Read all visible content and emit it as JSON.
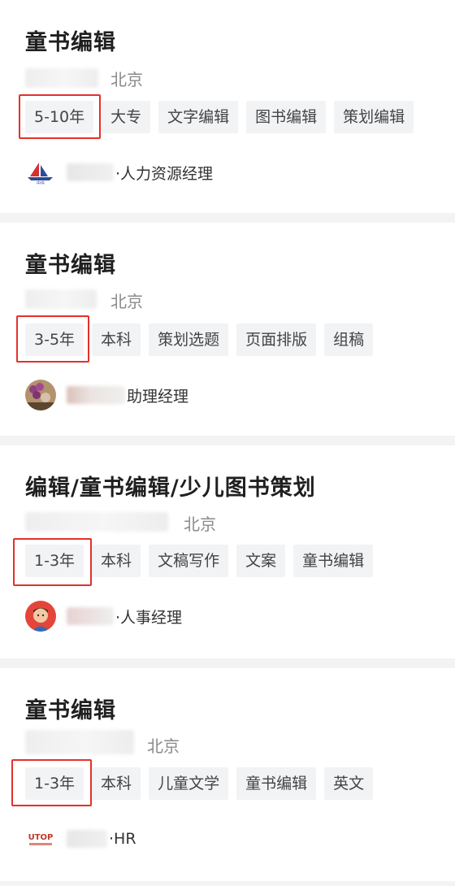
{
  "jobs": [
    {
      "title": "童书编辑",
      "city": "北京",
      "tags": [
        "5-10年",
        "大专",
        "文字编辑",
        "图书编辑",
        "策划编辑"
      ],
      "recruiter_role": "·人力资源经理",
      "recruiter_visual": "ship-logo-icon"
    },
    {
      "title": "童书编辑",
      "city": "北京",
      "tags": [
        "3-5年",
        "本科",
        "策划选题",
        "页面排版",
        "组稿"
      ],
      "recruiter_role": "助理经理",
      "recruiter_visual": "flower-avatar"
    },
    {
      "title": "编辑/童书编辑/少儿图书策划",
      "city": "北京",
      "tags": [
        "1-3年",
        "本科",
        "文稿写作",
        "文案",
        "童书编辑"
      ],
      "recruiter_role": "·人事经理",
      "recruiter_visual": "cartoon-person-avatar"
    },
    {
      "title": "童书编辑",
      "city": "北京",
      "tags": [
        "1-3年",
        "本科",
        "儿童文学",
        "童书编辑",
        "英文"
      ],
      "recruiter_role": "·HR",
      "recruiter_visual": "utop-logo-icon"
    }
  ],
  "logo_text": {
    "ship": "中信",
    "utop": "UTOP"
  },
  "colors": {
    "highlight_box": "#e4312b",
    "tag_bg": "#f2f3f4",
    "page_bg": "#f3f3f3"
  }
}
